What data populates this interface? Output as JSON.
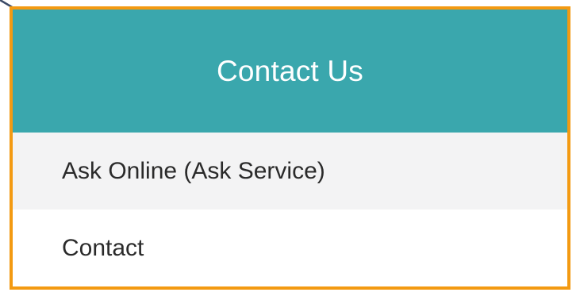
{
  "colors": {
    "header_bg": "#3aa7ad",
    "border_accent": "#f39a12",
    "row_alt_bg": "#f3f3f4",
    "text": "#2a2a2a"
  },
  "panel": {
    "title": "Contact Us",
    "items": [
      {
        "label": "Ask Online (Ask Service)"
      },
      {
        "label": "Contact"
      }
    ]
  }
}
